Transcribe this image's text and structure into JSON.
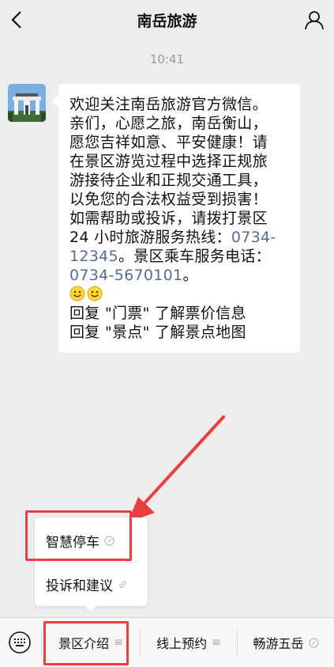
{
  "header": {
    "title": "南岳旅游"
  },
  "chat": {
    "time": "10:41",
    "message_lines": [
      "欢迎关注南岳旅游官方微信。",
      "亲们，心愿之旅，南岳衡山，",
      "愿您吉祥如意、平安健康！请",
      "在景区游览过程中选择正规旅",
      "游接待企业和正规交通工具，",
      "以免您的合法权益受到损害！",
      "如需帮助或投诉，请拨打景区"
    ],
    "hotline_prefix": "24 小时旅游服务热线：",
    "hotline_a": "0734-",
    "hotline_b": "12345",
    "bus_text": "。景区乘车服务电话：",
    "bus_number": "0734-5670101",
    "bus_end": "。",
    "reply_1": "回复 \"门票\" 了解票价信息",
    "reply_2": "回复 \"景点\" 了解景点地图"
  },
  "submenu": {
    "items": [
      {
        "label": "智慧停车",
        "icon": "link-icon"
      },
      {
        "label": "投诉和建议",
        "icon": "link-icon"
      }
    ]
  },
  "bottom_menu": {
    "items": [
      {
        "label": "景区介绍",
        "icon": "list-icon"
      },
      {
        "label": "线上预约",
        "icon": "list-icon"
      },
      {
        "label": "畅游五岳",
        "icon": "link-icon"
      }
    ]
  },
  "colors": {
    "highlight": "#ea3f3f",
    "link": "#576b95",
    "background": "#ededed"
  }
}
